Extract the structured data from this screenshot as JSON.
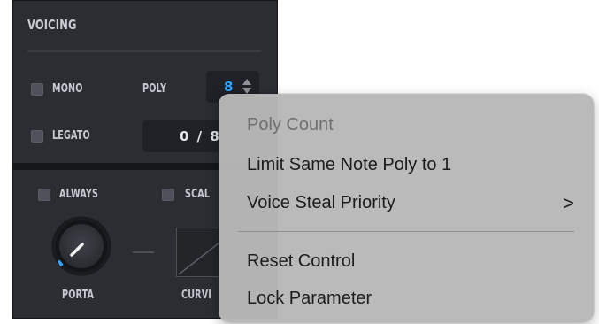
{
  "voicing": {
    "title": "VOICING",
    "mono_label": "MONO",
    "poly_label": "POLY",
    "poly_value": "8",
    "legato_label": "LEGATO",
    "voices_display": "0 / 8"
  },
  "glide": {
    "always_label": "ALWAYS",
    "scale_label": "SCAL",
    "porta_label": "PORTA",
    "curve_label": "CURVI"
  },
  "context_menu": {
    "header": "Poly Count",
    "items": [
      {
        "label": "Limit Same Note Poly to 1"
      },
      {
        "label": "Voice Steal Priority",
        "submenu_glyph": ">"
      },
      {
        "label": "Reset Control"
      },
      {
        "label": "Lock Parameter"
      }
    ]
  },
  "colors": {
    "panel_bg": "#2b2d33",
    "accent": "#2fa6ff",
    "menu_bg": "#b8b8b8"
  }
}
